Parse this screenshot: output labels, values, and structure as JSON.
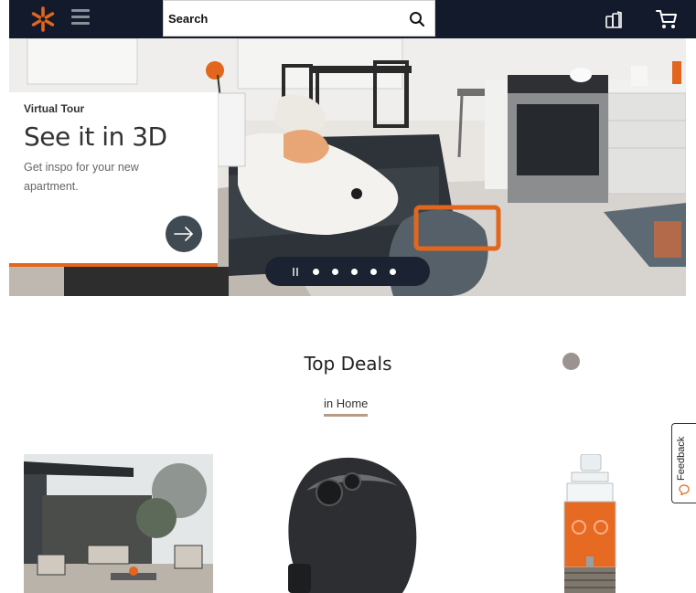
{
  "header": {
    "logo_icon": "walmart-spark-icon",
    "menu_icon": "hamburger-menu-icon",
    "search": {
      "placeholder": "Search",
      "icon": "search-icon"
    },
    "lists_icon": "lists-icon",
    "cart_icon": "cart-icon"
  },
  "hero": {
    "eyebrow": "Virtual Tour",
    "title": "See it in 3D",
    "description": "Get inspo for your new apartment.",
    "arrow_icon": "arrow-right-icon",
    "carousel": {
      "pause_icon": "pause-icon",
      "slide_count": 5
    },
    "accent_color": "#e2661d"
  },
  "deals": {
    "title": "Top Deals",
    "tab": "in Home",
    "tab_underline_color": "#b79c85",
    "products": [
      {
        "image": "patio-furniture-set"
      },
      {
        "image": "air-fryer"
      },
      {
        "image": "glass-drink-dispenser"
      }
    ]
  },
  "feedback": {
    "label": "Feedback",
    "icon": "speech-bubble-icon"
  },
  "colors": {
    "header_bg": "#131a2b",
    "brand_orange": "#e2661d"
  }
}
